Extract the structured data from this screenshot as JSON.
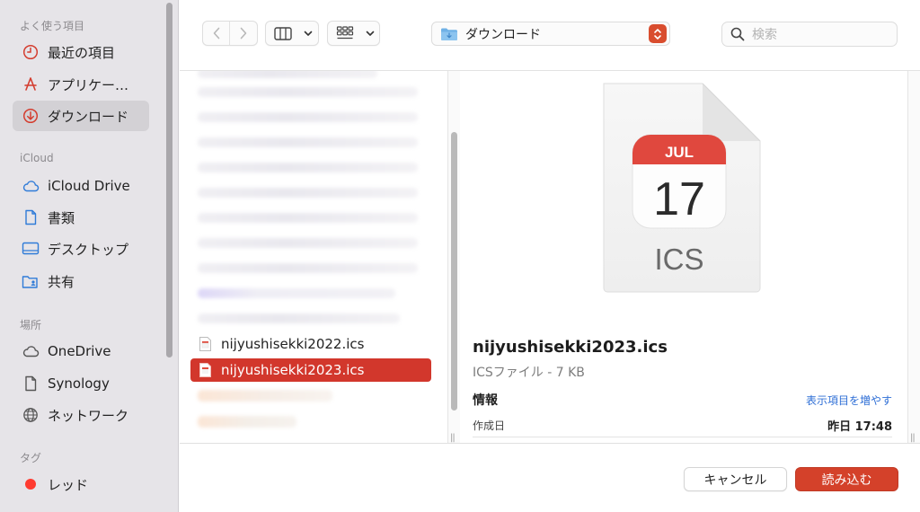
{
  "sidebar": {
    "sections": {
      "favorites": "よく使う項目",
      "icloud": "iCloud",
      "locations": "場所",
      "tags": "タグ"
    },
    "favorites": [
      {
        "label": "最近の項目",
        "icon": "clock-icon"
      },
      {
        "label": "アプリケー…",
        "icon": "applications-icon"
      },
      {
        "label": "ダウンロード",
        "icon": "download-icon",
        "selected": true
      }
    ],
    "icloud": [
      {
        "label": "iCloud Drive",
        "icon": "cloud-icon"
      },
      {
        "label": "書類",
        "icon": "document-icon"
      },
      {
        "label": "デスクトップ",
        "icon": "desktop-icon"
      },
      {
        "label": "共有",
        "icon": "shared-folder-icon"
      }
    ],
    "locations": [
      {
        "label": "OneDrive",
        "icon": "cloud-icon"
      },
      {
        "label": "Synology",
        "icon": "document-icon"
      },
      {
        "label": "ネットワーク",
        "icon": "globe-icon"
      }
    ],
    "tags": [
      {
        "label": "レッド",
        "color": "#ff3b30"
      }
    ]
  },
  "toolbar": {
    "location": "ダウンロード",
    "search_placeholder": "検索"
  },
  "files": [
    {
      "name": "nijyushisekki2022.ics",
      "selected": false
    },
    {
      "name": "nijyushisekki2023.ics",
      "selected": true
    }
  ],
  "preview": {
    "icon": {
      "month": "JUL",
      "day": "17",
      "ext": "ICS"
    },
    "name": "nijyushisekki2023.ics",
    "kind": "ICSファイル - 7 KB",
    "info_heading": "情報",
    "show_more": "表示項目を増やす",
    "created_label": "作成日",
    "created_value": "昨日 17:48"
  },
  "buttons": {
    "cancel": "キャンセル",
    "open": "読み込む"
  },
  "colors": {
    "accent": "#d4412a",
    "selection": "#d2372c",
    "sidebar_icon": "#d43d2f"
  }
}
